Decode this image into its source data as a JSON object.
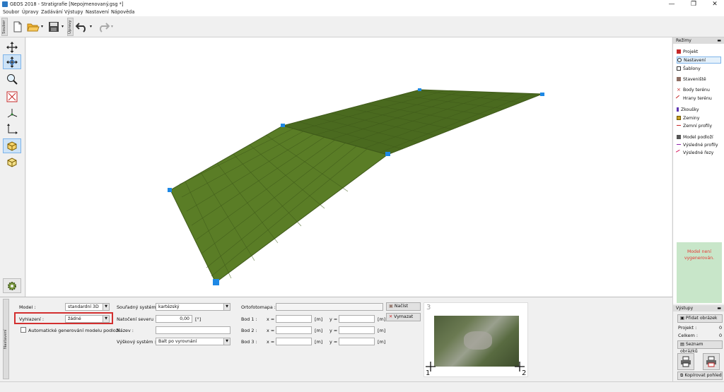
{
  "window": {
    "title": "GEOS 2018 - Stratigrafie [Nepojmenovaný.gsg *]",
    "minimize": "—",
    "maximize": "❐",
    "close": "✕"
  },
  "menu": [
    "Soubor",
    "Úpravy",
    "Zadávání",
    "Výstupy",
    "Nastavení",
    "Nápověda"
  ],
  "toolbar": {
    "file_tab": "Soubor",
    "edit_tab": "Úpravy"
  },
  "left_tools": [
    "move-icon",
    "pan-icon",
    "zoom-icon",
    "zoom-extents-icon",
    "axes-3d-icon",
    "axes-2d-icon",
    "box-view-icon",
    "box-plain-icon",
    "settings-icon"
  ],
  "modes": {
    "header": "Režimy",
    "items": [
      {
        "label": "Projekt",
        "icon": "project-icon",
        "selected": false
      },
      {
        "label": "Nastavení",
        "icon": "gear-icon",
        "selected": true
      },
      {
        "label": "Šablony",
        "icon": "template-icon",
        "selected": false
      },
      {
        "label": "Staveniště",
        "icon": "site-icon",
        "selected": false
      },
      {
        "label": "Body terénu",
        "icon": "terrain-points-icon",
        "selected": false
      },
      {
        "label": "Hrany terénu",
        "icon": "terrain-edges-icon",
        "selected": false
      },
      {
        "label": "Zkoušky",
        "icon": "tests-icon",
        "selected": false
      },
      {
        "label": "Zeminy",
        "icon": "soils-icon",
        "selected": false
      },
      {
        "label": "Zemní profily",
        "icon": "soil-profiles-icon",
        "selected": false
      },
      {
        "label": "Model podloží",
        "icon": "subsoil-model-icon",
        "selected": false
      },
      {
        "label": "Výsledné profily",
        "icon": "result-profiles-icon",
        "selected": false
      },
      {
        "label": "Výsledné řezy",
        "icon": "result-sections-icon",
        "selected": false
      }
    ],
    "status_message": "Model není vygenerován."
  },
  "settings": {
    "model_label": "Model :",
    "model_value": "standardní 3D",
    "smoothing_label": "Vyhlazení :",
    "smoothing_value": "žádné",
    "auto_generate_label": "Automatické generování modelu podloží",
    "coord_system_label": "Souřadný systém :",
    "coord_system_value": "kartézský",
    "north_rotation_label": "Natočení severu :",
    "north_rotation_value": "0,00",
    "north_rotation_unit": "[°]",
    "name_label": "Název :",
    "name_value": "",
    "height_system_label": "Výškový systém :",
    "height_system_value": "Balt po vyrovnání",
    "orthophoto_label": "Ortofotomapa :",
    "load_button": "Načíst",
    "delete_button": "Vymazat",
    "points": [
      {
        "label": "Bod 1 :",
        "x": "",
        "y": ""
      },
      {
        "label": "Bod 2 :",
        "x": "",
        "y": ""
      },
      {
        "label": "Bod 3 :",
        "x": "",
        "y": ""
      }
    ],
    "x_label": "x =",
    "y_label": "y =",
    "unit_m": "[m]",
    "marker_1": "1",
    "marker_2": "2",
    "marker_3": "3",
    "side_tab": "Nastavení"
  },
  "outputs": {
    "header": "Výstupy",
    "add_image_button": "Přidat obrázek",
    "project_label": "Projekt :",
    "project_count": "0",
    "total_label": "Celkem :",
    "total_count": "0",
    "image_list_button": "Seznam obrázků",
    "copy_view_button": "Kopírovat pohled"
  },
  "colors": {
    "surface_light": "#5a7d26",
    "surface_dark": "#4a6a1f",
    "grid": "#3f5a1a",
    "handle": "#1e88e5",
    "highlight_border": "#d32f2f",
    "status_text": "#e53935",
    "status_bg": "#c8e6c9"
  }
}
